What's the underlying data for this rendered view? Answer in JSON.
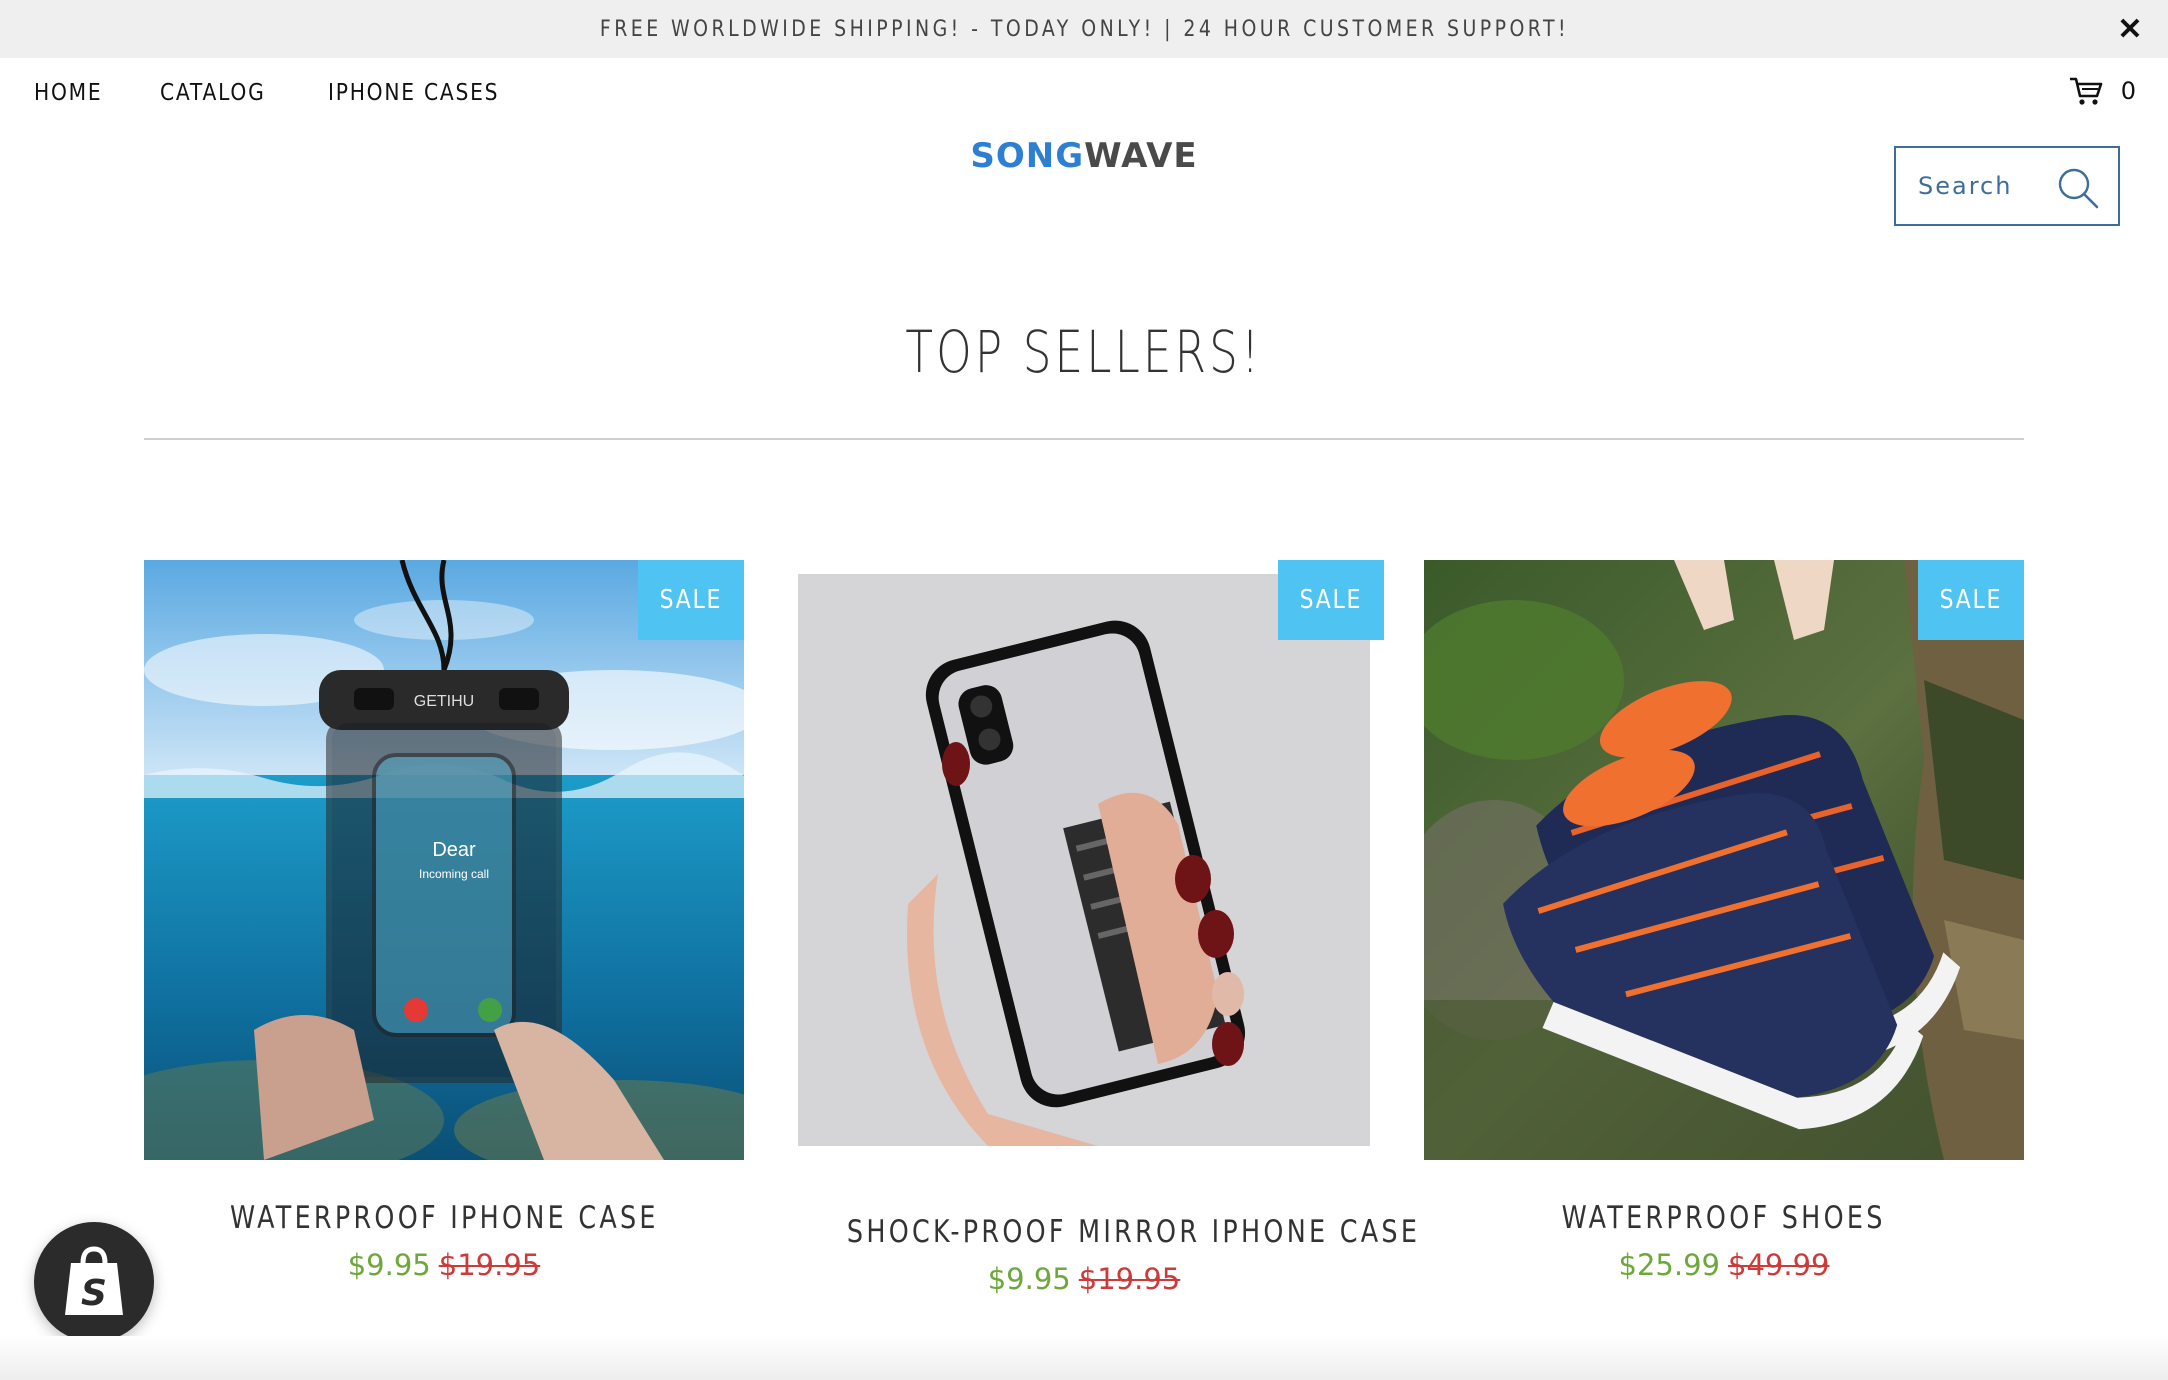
{
  "announcement": {
    "text": "FREE WORLDWIDE SHIPPING! - TODAY ONLY! | 24 HOUR CUSTOMER SUPPORT!",
    "close_icon": "close-icon"
  },
  "nav": {
    "items": [
      {
        "label": "HOME"
      },
      {
        "label": "CATALOG"
      },
      {
        "label": "IPHONE CASES"
      }
    ]
  },
  "cart": {
    "icon": "cart-icon",
    "count": "0"
  },
  "logo": {
    "part1": "SONG",
    "part2": "WAVE"
  },
  "search": {
    "placeholder": "Search",
    "icon": "search-icon"
  },
  "section": {
    "title": "TOP SELLERS!"
  },
  "products": [
    {
      "title": "WATERPROOF IPHONE CASE",
      "price": "$9.95",
      "compare_price": "$19.95",
      "badge": "SALE",
      "image": {
        "brand": "GETIHU",
        "caller": "Dear",
        "call_status": "Incoming call"
      }
    },
    {
      "title": "SHOCK-PROOF MIRROR IPHONE CASE",
      "price": "$9.95",
      "compare_price": "$19.95",
      "badge": "SALE"
    },
    {
      "title": "WATERPROOF SHOES",
      "price": "$25.99",
      "compare_price": "$49.99",
      "badge": "SALE"
    }
  ],
  "colors": {
    "accent_blue": "#4fc4f2",
    "price_green": "#6da83c",
    "price_red": "#cd3a3a",
    "logo_blue": "#2d7fd1"
  }
}
